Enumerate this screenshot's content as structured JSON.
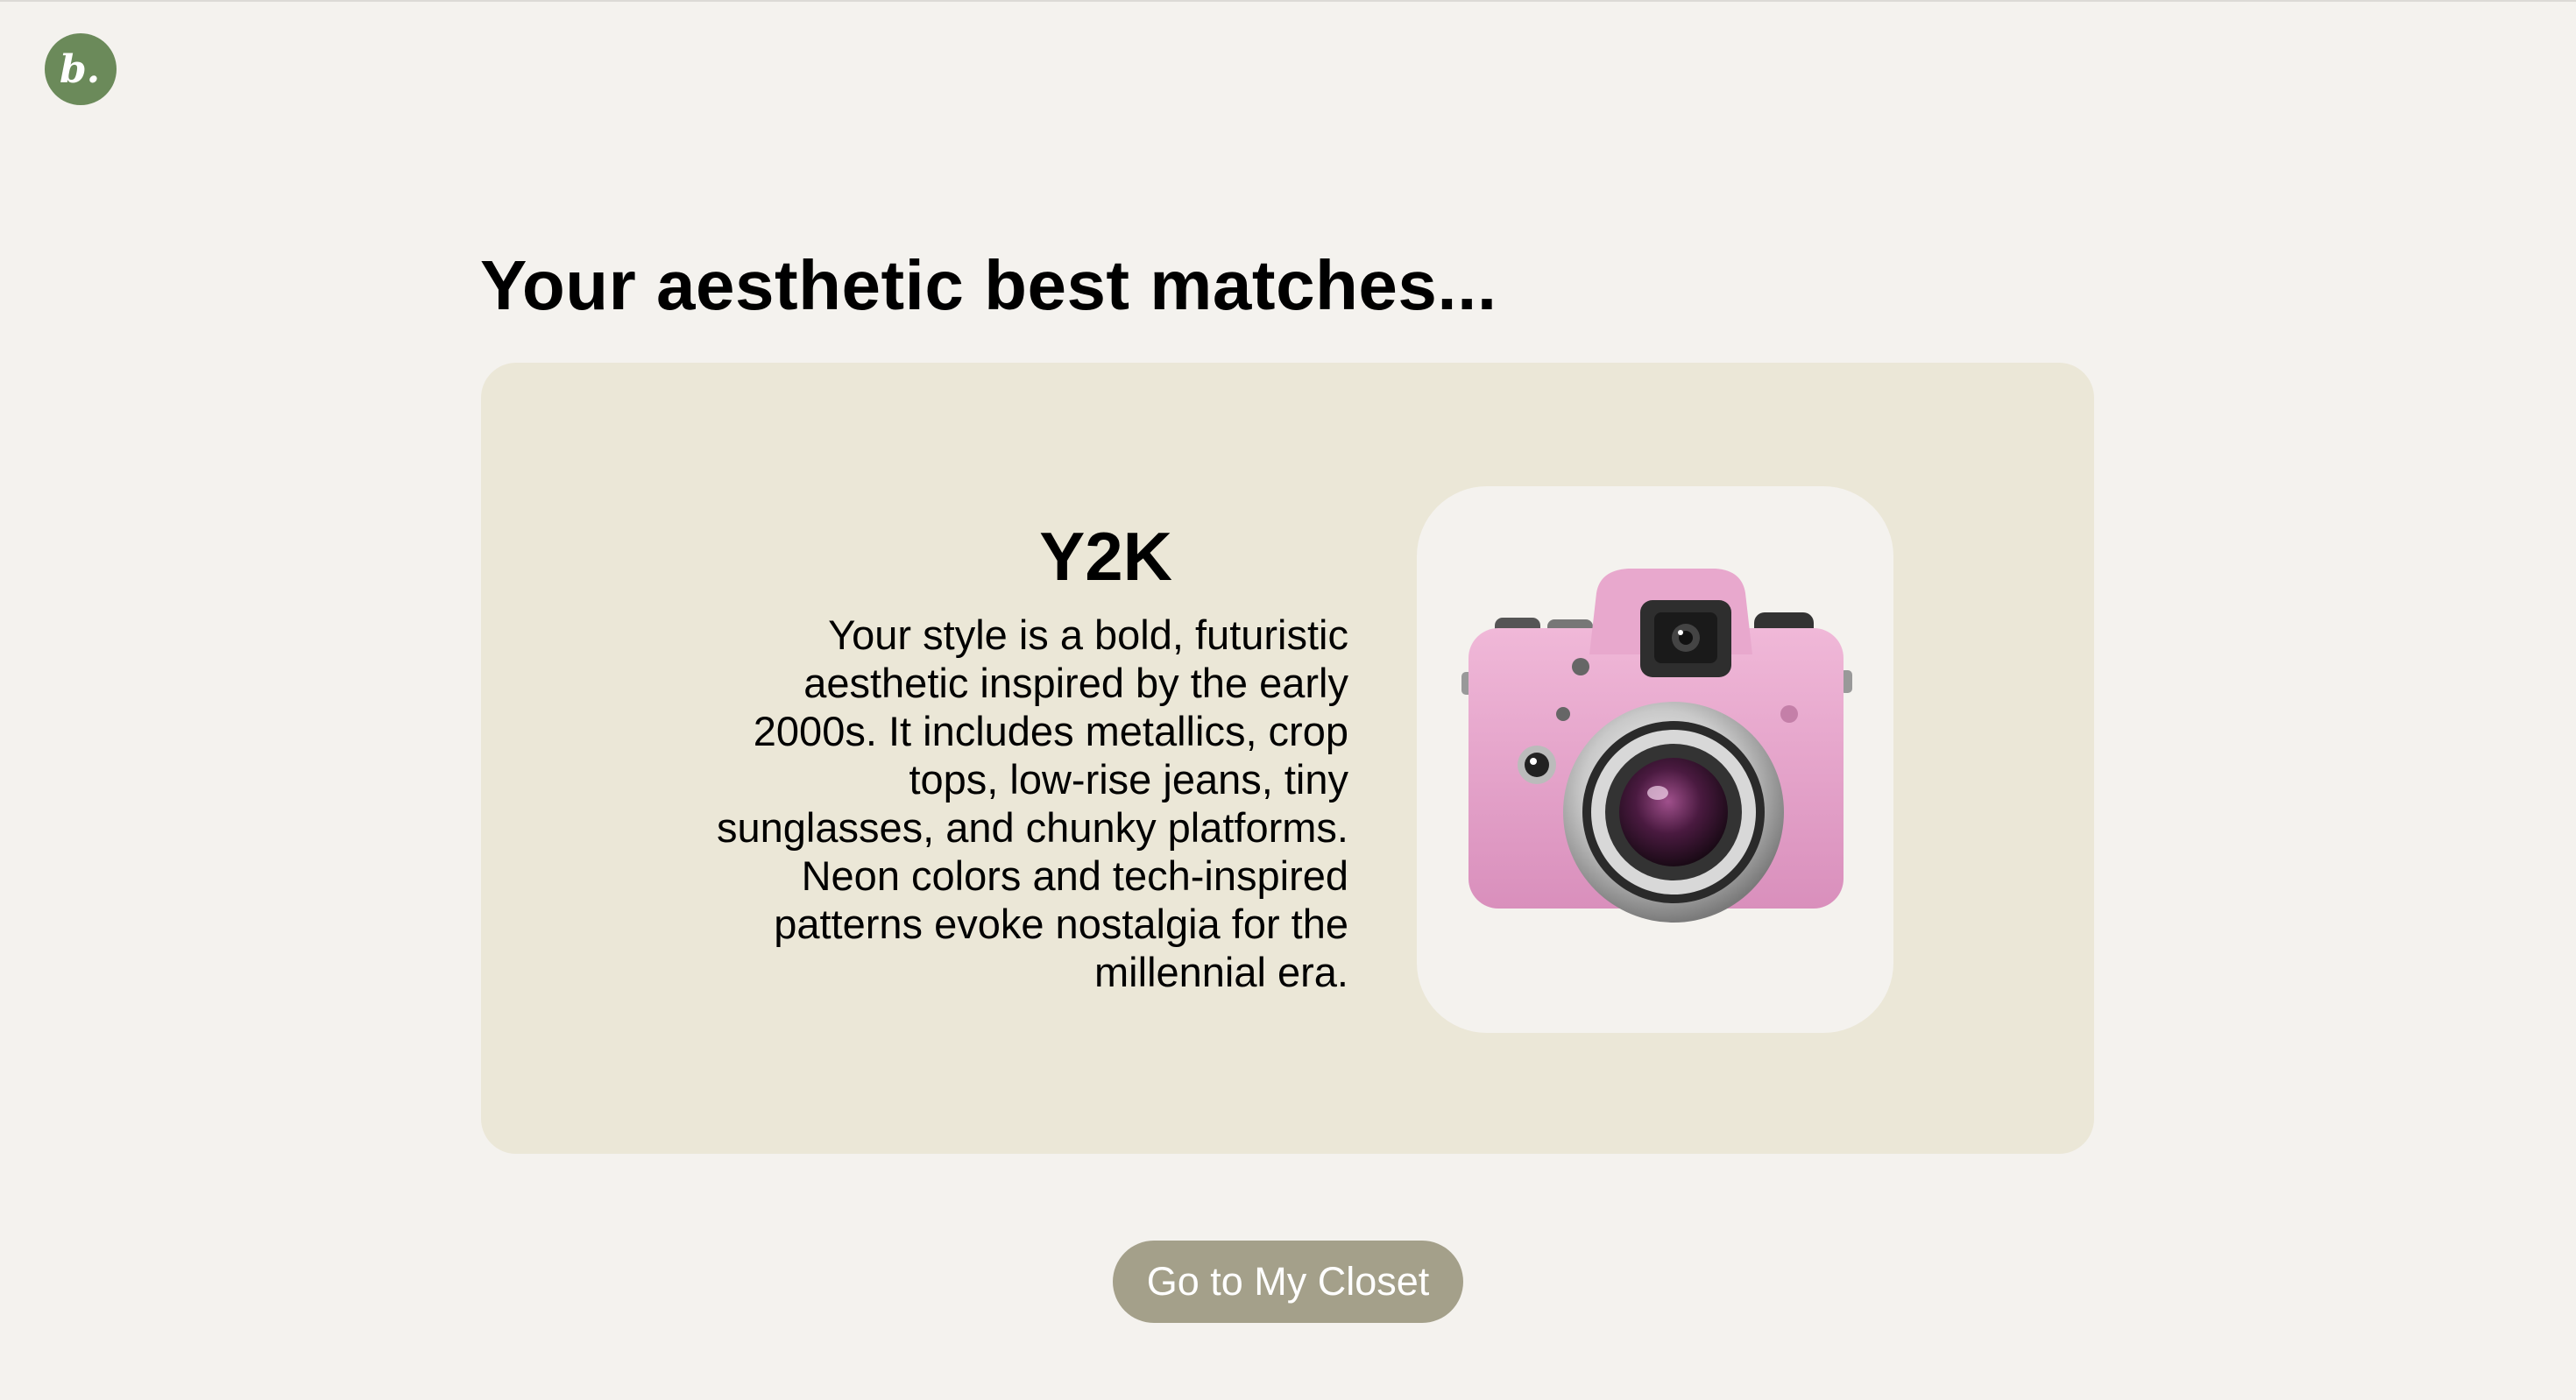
{
  "logo": {
    "letter": "b.",
    "icon": "brand-logo-icon",
    "color": "#6b8a5a"
  },
  "page_title": "Your aesthetic best matches...",
  "match": {
    "name": "Y2K",
    "description": "Your style is a bold, futuristic aesthetic inspired by the early 2000s. It includes metallics, crop tops, low-rise jeans, tiny sunglasses, and chunky platforms. Neon colors and tech-inspired patterns evoke nostalgia for the millennial era.",
    "image_icon": "pink-camera-icon",
    "card_color": "#ebe7d7"
  },
  "actions": {
    "closet_button_label": "Go to My Closet",
    "button_color": "#a4a08a"
  }
}
